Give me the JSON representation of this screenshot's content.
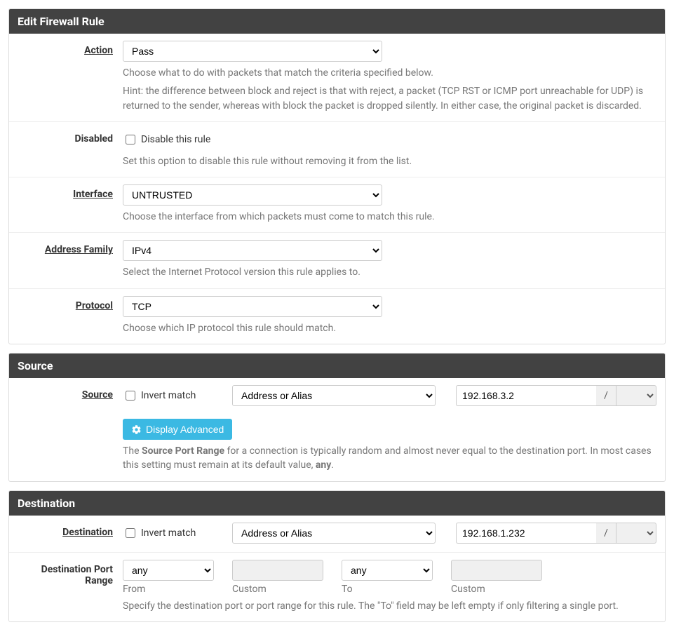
{
  "panels": {
    "edit": "Edit Firewall Rule",
    "source": "Source",
    "destination": "Destination"
  },
  "action": {
    "label": "Action",
    "value": "Pass",
    "help1": "Choose what to do with packets that match the criteria specified below.",
    "help2": "Hint: the difference between block and reject is that with reject, a packet (TCP RST or ICMP port unreachable for UDP) is returned to the sender, whereas with block the packet is dropped silently. In either case, the original packet is discarded."
  },
  "disabled": {
    "label": "Disabled",
    "chk_label": "Disable this rule",
    "help": "Set this option to disable this rule without removing it from the list."
  },
  "interface": {
    "label": "Interface",
    "value": "UNTRUSTED",
    "help": "Choose the interface from which packets must come to match this rule."
  },
  "af": {
    "label": "Address Family",
    "value": "IPv4",
    "help": "Select the Internet Protocol version this rule applies to."
  },
  "protocol": {
    "label": "Protocol",
    "value": "TCP",
    "help": "Choose which IP protocol this rule should match."
  },
  "source": {
    "label": "Source",
    "invert": "Invert match",
    "type": "Address or Alias",
    "addr": "192.168.3.2",
    "slash": "/",
    "advanced_btn": "Display Advanced",
    "help_pre": "The ",
    "help_bold": "Source Port Range",
    "help_mid": " for a connection is typically random and almost never equal to the destination port. In most cases this setting must remain at its default value, ",
    "help_bold2": "any",
    "help_post": "."
  },
  "dest": {
    "label": "Destination",
    "invert": "Invert match",
    "type": "Address or Alias",
    "addr": "192.168.1.232",
    "slash": "/"
  },
  "dport": {
    "label": "Destination Port Range",
    "from_val": "any",
    "from_lbl": "From",
    "custom1": "Custom",
    "to_val": "any",
    "to_lbl": "To",
    "custom2": "Custom",
    "help": "Specify the destination port or port range for this rule. The \"To\" field may be left empty if only filtering a single port."
  }
}
